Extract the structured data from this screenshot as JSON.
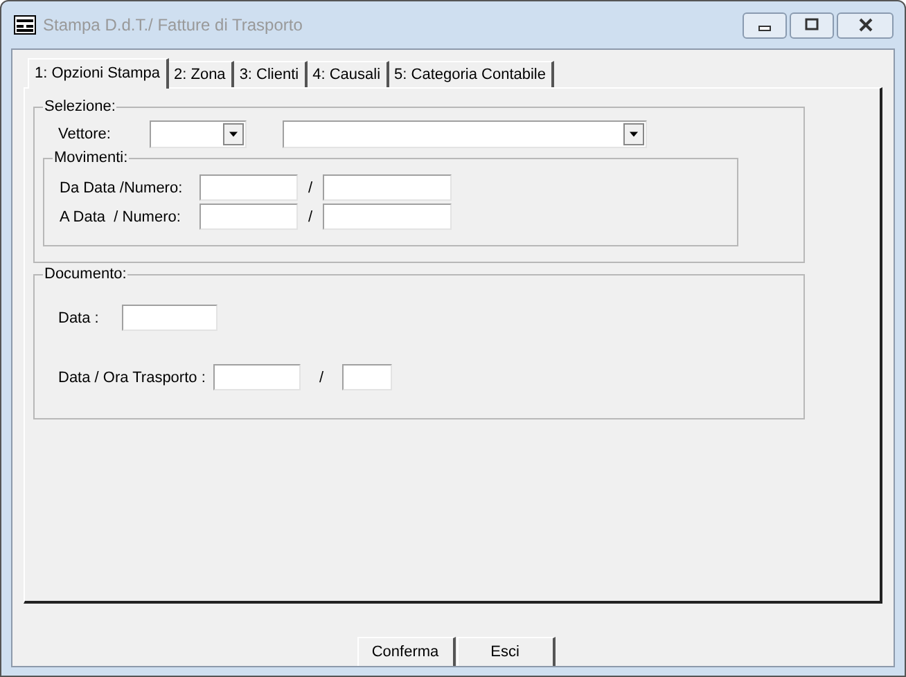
{
  "window": {
    "title": "Stampa D.d.T./ Fatture di Trasporto"
  },
  "tabs": [
    {
      "label": "1: Opzioni Stampa",
      "selected": true
    },
    {
      "label": "2: Zona",
      "selected": false
    },
    {
      "label": "3: Clienti",
      "selected": false
    },
    {
      "label": "4: Causali",
      "selected": false
    },
    {
      "label": "5: Categoria Contabile",
      "selected": false
    }
  ],
  "selezione": {
    "title": "Selezione:",
    "vettore_label": "Vettore:",
    "movimenti": {
      "title": "Movimenti:",
      "rows": [
        {
          "label": "Da Data /Numero:",
          "separator": "/"
        },
        {
          "label": "A Data  / Numero:",
          "separator": "/"
        }
      ]
    }
  },
  "documento": {
    "title": "Documento:",
    "data_label": "Data :",
    "trasporto_label": "Data / Ora Trasporto :",
    "separator": "/"
  },
  "buttons": [
    "Conferma",
    "Esci"
  ]
}
